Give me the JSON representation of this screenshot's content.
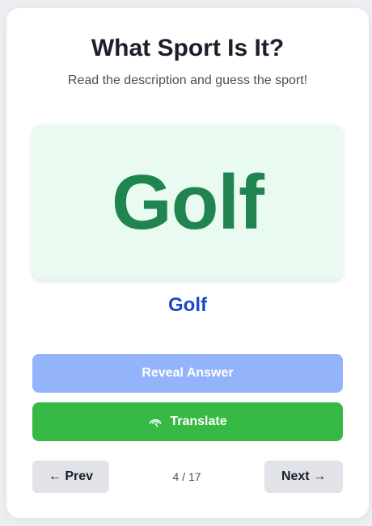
{
  "quiz": {
    "title": "What Sport Is It?",
    "subtitle": "Read the description and guess the sport!",
    "image_word": "Golf",
    "answer": "Golf"
  },
  "buttons": {
    "reveal_label": "Reveal Answer",
    "translate_label": "Translate",
    "translate_icon": "translate-icon",
    "prev_label": "← Prev",
    "next_label": "Next →"
  },
  "pager": {
    "text": "4 / 17",
    "current": 4,
    "total": 17
  },
  "colors": {
    "background": "#eceef2",
    "card": "#ffffff",
    "image_panel_bg": "#e9faf0",
    "image_word": "#1f8450",
    "answer": "#1e46c8",
    "reveal_button": "#93b3fb",
    "translate_button": "#37b946",
    "nav_button": "#e1e3e8"
  }
}
